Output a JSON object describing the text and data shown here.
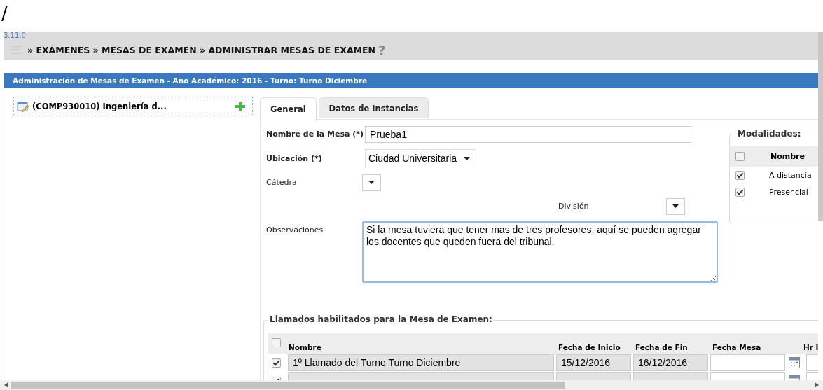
{
  "page_path": "/",
  "version": "3.11.0",
  "breadcrumb": "» EXÁMENES » MESAS DE EXAMEN » ADMINISTRAR MESAS DE EXAMEN",
  "help": "?",
  "panel_title": "Administración de Mesas de Examen - Año Académico: 2016 - Turno: Turno Diciembre",
  "tree": {
    "item": "(COMP930010) Ingeniería d...",
    "selected": true
  },
  "tabs": [
    {
      "label": "General",
      "selected": true
    },
    {
      "label": "Datos de Instancias",
      "selected": false
    }
  ],
  "form": {
    "nombre": {
      "label": "Nombre de la Mesa (*)",
      "value": "Prueba1"
    },
    "ubicacion": {
      "label": "Ubicación (*)",
      "value": "Ciudad Universitaria"
    },
    "catedra": {
      "label": "Cátedra"
    },
    "division": {
      "label": "División"
    },
    "observaciones": {
      "label": "Observaciones",
      "value": "Si la mesa tuviera que tener mas de tres profesores, aquí se pueden agregar los docentes que queden fuera del tribunal."
    }
  },
  "modalidades": {
    "title": "Modalidades:",
    "all_checked": false,
    "column": "Nombre",
    "items": [
      {
        "label": "A distancia",
        "checked": true
      },
      {
        "label": "Presencial",
        "checked": true
      }
    ]
  },
  "llamados": {
    "title": "Llamados habilitados para la Mesa de Examen:",
    "all_checked": false,
    "columns": [
      "Nombre",
      "Fecha de Inicio",
      "Fecha de Fin",
      "Fecha Mesa",
      "Hr I"
    ],
    "rows": [
      {
        "checked": true,
        "nombre": "1º Llamado del Turno Turno Diciembre",
        "inicio": "15/12/2016",
        "fin": "16/12/2016"
      },
      {
        "checked": true
      }
    ]
  }
}
